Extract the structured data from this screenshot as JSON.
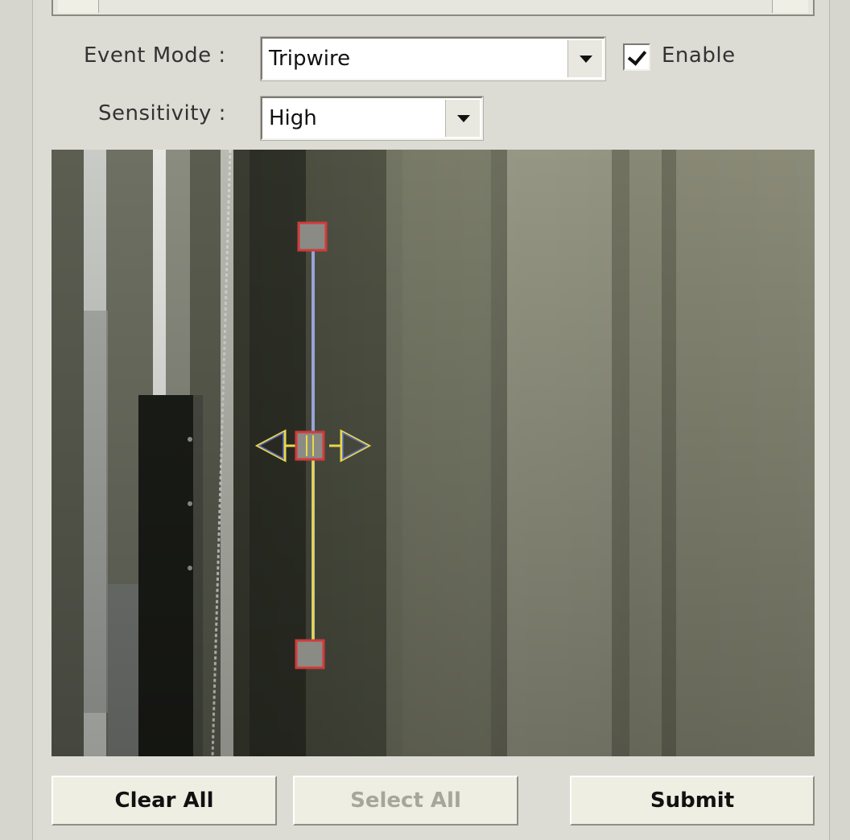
{
  "form": {
    "event_mode_label": "Event Mode :",
    "event_mode_value": "Tripwire",
    "enable_label": "Enable",
    "enable_checked": true,
    "sensitivity_label": "Sensitivity :",
    "sensitivity_value": "High"
  },
  "buttons": {
    "clear_all": "Clear All",
    "select_all": "Select All",
    "submit": "Submit"
  },
  "overlay": {
    "type": "tripwire",
    "line_color": "#e8d84a",
    "handle_color": "#d23a3a",
    "direction_arrows": "bidirectional"
  }
}
